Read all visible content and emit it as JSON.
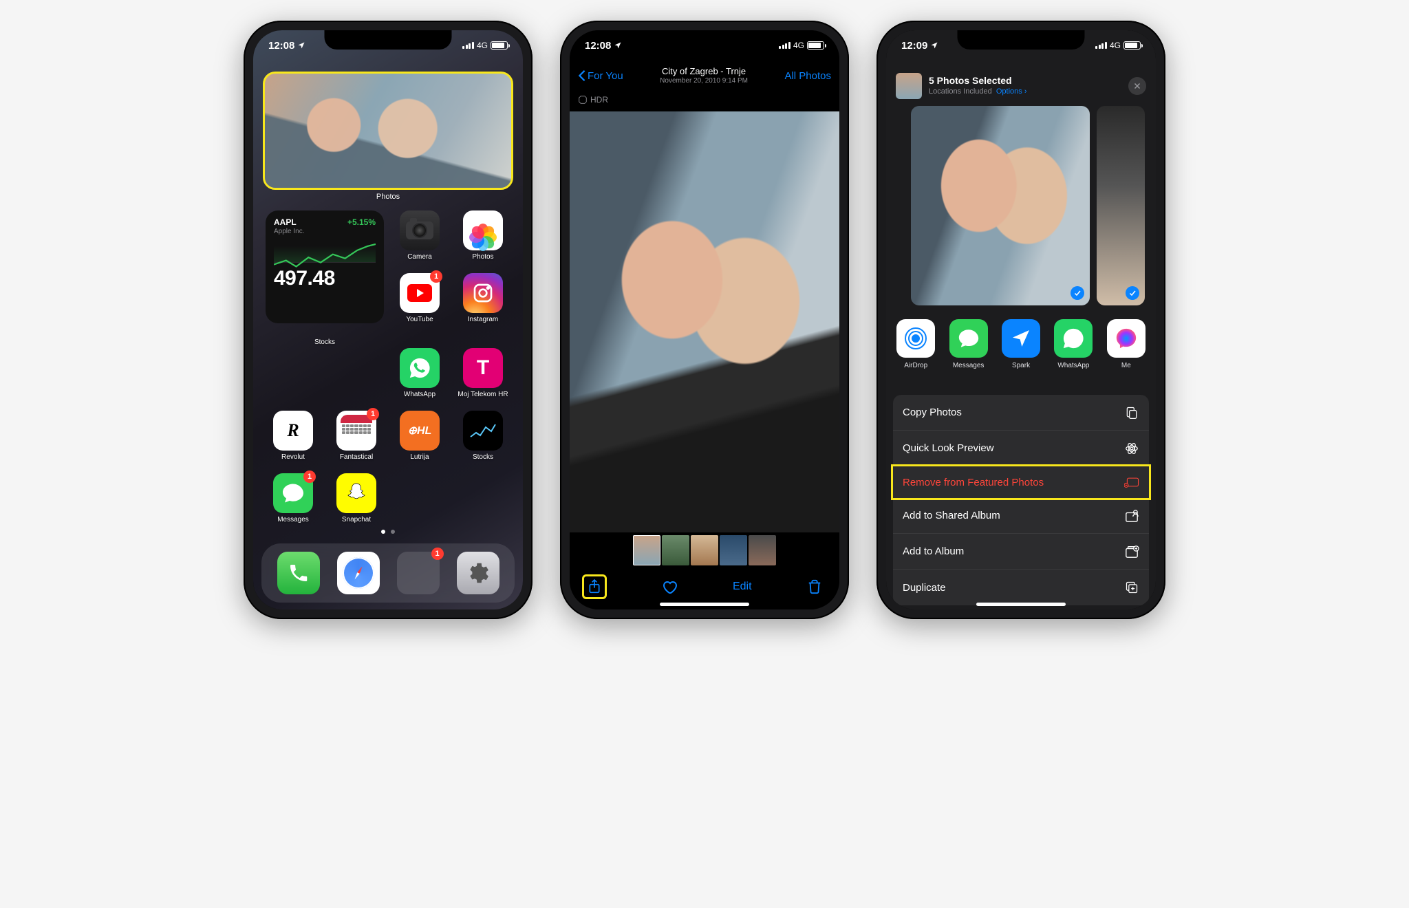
{
  "statusbar": {
    "time1": "12:08",
    "time2": "12:08",
    "time3": "12:09",
    "network": "4G"
  },
  "screen1": {
    "widget_label": "Photos",
    "stocks": {
      "ticker": "AAPL",
      "pct": "+5.15%",
      "company": "Apple Inc.",
      "price": "497.48",
      "label": "Stocks"
    },
    "apps": {
      "camera": "Camera",
      "photos": "Photos",
      "youtube": "YouTube",
      "instagram": "Instagram",
      "whatsapp": "WhatsApp",
      "telekom": "Moj Telekom HR",
      "revolut": "Revolut",
      "fantastical": "Fantastical",
      "lutrija": "Lutrija",
      "stocks": "Stocks",
      "messages": "Messages",
      "snapchat": "Snapchat"
    },
    "badges": {
      "youtube": "1",
      "fantastical": "1",
      "messages": "1"
    }
  },
  "screen2": {
    "back": "For You",
    "title": "City of Zagreb - Trnje",
    "subtitle": "November 20, 2010  9:14 PM",
    "all_photos": "All Photos",
    "hdr": "HDR",
    "edit": "Edit"
  },
  "screen3": {
    "title": "5 Photos Selected",
    "sub_loc": "Locations Included",
    "sub_opt": "Options",
    "share_apps": {
      "airdrop": "AirDrop",
      "messages": "Messages",
      "spark": "Spark",
      "whatsapp": "WhatsApp",
      "messenger": "Me"
    },
    "actions": {
      "copy": "Copy Photos",
      "quicklook": "Quick Look Preview",
      "remove": "Remove from Featured Photos",
      "shared_album": "Add to Shared Album",
      "album": "Add to Album",
      "duplicate": "Duplicate"
    }
  }
}
